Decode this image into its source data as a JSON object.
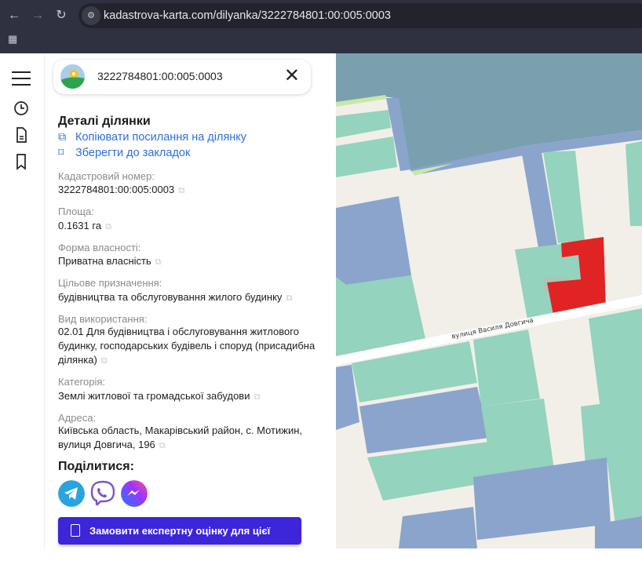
{
  "browser": {
    "url": "kadastrova-karta.com/dilyanka/3222784801:00:005:0003"
  },
  "search": {
    "value": "3222784801:00:005:0003"
  },
  "details": {
    "title": "Деталі ділянки",
    "copy_link": "Копіювати посилання на ділянку",
    "bookmark": "Зберегти до закладок",
    "fields": [
      {
        "label": "Кадастровий номер:",
        "value": "3222784801:00:005:0003"
      },
      {
        "label": "Площа:",
        "value": "0.1631 га"
      },
      {
        "label": "Форма власності:",
        "value": "Приватна власність"
      },
      {
        "label": "Цільове призначення:",
        "value": "будівництва та обслуговування жилого будинку"
      },
      {
        "label": "Вид використання:",
        "value": "02.01 Для будівництва і обслуговування житлового будинку, господарських будівель і споруд (присадибна ділянка)"
      },
      {
        "label": "Категорія:",
        "value": "Землі житлової та громадської забудови"
      },
      {
        "label": "Адреса:",
        "value": "Київська область, Макарівський район, с. Мотижин, вулиця Довгича, 196"
      }
    ]
  },
  "share": {
    "title": "Поділитися:"
  },
  "cta": {
    "label": "Замовити експертну оцінку для цієї ділянки"
  },
  "map": {
    "street_label": "вулиця Василя Довгича",
    "colors": {
      "selected": "#e02424",
      "residential": "#94d3bd",
      "other": "#8aa4cc",
      "water": "#7aa0b0"
    }
  }
}
